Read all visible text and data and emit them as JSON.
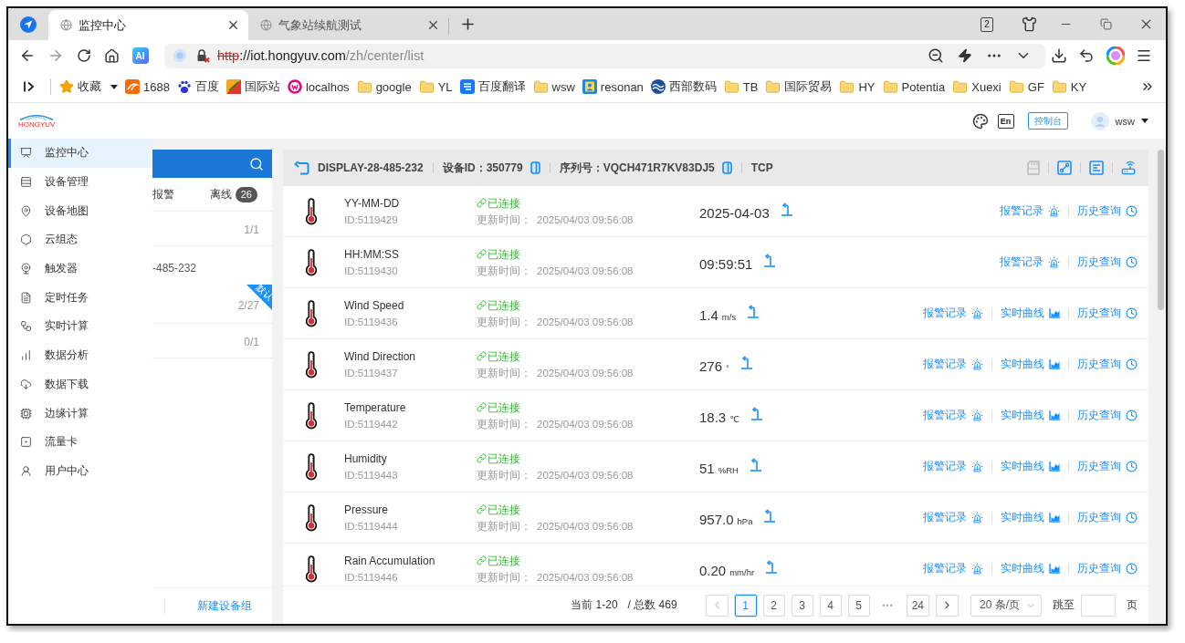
{
  "browser": {
    "tabs": [
      {
        "title": "监控中心",
        "selected": true
      },
      {
        "title": "气象站续航测试",
        "selected": false
      }
    ],
    "window_count": "2",
    "ai_label": "AI",
    "address": {
      "secure": false,
      "scheme": "http",
      "authority": "://iot.hongyuv.com",
      "path": "/zh/center/list"
    },
    "bookmarks": [
      {
        "kind": "favorites",
        "label": "收藏"
      },
      {
        "kind": "site",
        "label": "1688"
      },
      {
        "kind": "site",
        "label": "百度"
      },
      {
        "kind": "site",
        "label": "国际站"
      },
      {
        "kind": "site",
        "label": "localhos"
      },
      {
        "kind": "folder",
        "label": "google"
      },
      {
        "kind": "folder",
        "label": "YL"
      },
      {
        "kind": "site",
        "label": "百度翻译"
      },
      {
        "kind": "folder",
        "label": "wsw"
      },
      {
        "kind": "site",
        "label": "resonan"
      },
      {
        "kind": "site",
        "label": "西部数码"
      },
      {
        "kind": "folder",
        "label": "TB"
      },
      {
        "kind": "folder",
        "label": "国际贸易"
      },
      {
        "kind": "folder",
        "label": "HY"
      },
      {
        "kind": "folder",
        "label": "Potentia"
      },
      {
        "kind": "folder",
        "label": "Xuexi"
      },
      {
        "kind": "folder",
        "label": "GF"
      },
      {
        "kind": "folder",
        "label": "KY"
      }
    ]
  },
  "app": {
    "logo_text": "HONGYUV",
    "lang_label": "En",
    "console_label": "控制台",
    "user": "wsw",
    "nav": [
      {
        "label": "监控中心",
        "selected": true
      },
      {
        "label": "设备管理",
        "selected": false
      },
      {
        "label": "设备地图",
        "selected": false
      },
      {
        "label": "云组态",
        "selected": false
      },
      {
        "label": "触发器",
        "selected": false
      },
      {
        "label": "定时任务",
        "selected": false
      },
      {
        "label": "实时计算",
        "selected": false
      },
      {
        "label": "数据分析",
        "selected": false
      },
      {
        "label": "数据下载",
        "selected": false
      },
      {
        "label": "边缘计算",
        "selected": false
      },
      {
        "label": "流量卡",
        "selected": false
      },
      {
        "label": "用户中心",
        "selected": false
      }
    ],
    "groups": {
      "tabs": [
        {
          "label": "报警"
        },
        {
          "label": "离线",
          "count": "26"
        }
      ],
      "items": [
        {
          "count": "1/1"
        },
        {
          "text": "-485-232",
          "count": "2/27",
          "tag": "默认"
        },
        {
          "count": "0/1"
        }
      ],
      "create_label": "新建设备组"
    },
    "device": {
      "name": "DISPLAY-28-485-232",
      "device_id": "设备ID：350779",
      "serial": "序列号：VQCH471R7KV83DJ5",
      "protocol": "TCP",
      "tools": [
        {
          "disabled": true
        },
        {
          "disabled": false
        },
        {
          "disabled": false
        },
        {
          "disabled": false
        }
      ]
    },
    "sensors": [
      {
        "name": "YY-MM-DD",
        "id": "ID:5119429",
        "status": "已连接",
        "updated_label": "更新时间：",
        "updated": "2025/04/03 09:56:08",
        "value": "2025-04-03",
        "actions": [
          {
            "kind": "alarm",
            "label": "报警记录"
          },
          {
            "kind": "history",
            "label": "历史查询"
          }
        ]
      },
      {
        "name": "HH:MM:SS",
        "id": "ID:5119430",
        "status": "已连接",
        "updated_label": "更新时间：",
        "updated": "2025/04/03 09:56:08",
        "value": "09:59:51",
        "actions": [
          {
            "kind": "alarm",
            "label": "报警记录"
          },
          {
            "kind": "history",
            "label": "历史查询"
          }
        ]
      },
      {
        "name": "Wind Speed",
        "id": "ID:5119436",
        "status": "已连接",
        "updated_label": "更新时间：",
        "updated": "2025/04/03 09:56:08",
        "value": "1.4",
        "unit": "m/s",
        "actions": [
          {
            "kind": "alarm",
            "label": "报警记录"
          },
          {
            "kind": "curve",
            "label": "实时曲线"
          },
          {
            "kind": "history",
            "label": "历史查询"
          }
        ]
      },
      {
        "name": "Wind Direction",
        "id": "ID:5119437",
        "status": "已连接",
        "updated_label": "更新时间：",
        "updated": "2025/04/03 09:56:08",
        "value": "276",
        "unit": "°",
        "actions": [
          {
            "kind": "alarm",
            "label": "报警记录"
          },
          {
            "kind": "curve",
            "label": "实时曲线"
          },
          {
            "kind": "history",
            "label": "历史查询"
          }
        ]
      },
      {
        "name": "Temperature",
        "id": "ID:5119442",
        "status": "已连接",
        "updated_label": "更新时间：",
        "updated": "2025/04/03 09:56:08",
        "value": "18.3",
        "unit": "℃",
        "actions": [
          {
            "kind": "alarm",
            "label": "报警记录"
          },
          {
            "kind": "curve",
            "label": "实时曲线"
          },
          {
            "kind": "history",
            "label": "历史查询"
          }
        ]
      },
      {
        "name": "Humidity",
        "id": "ID:5119443",
        "status": "已连接",
        "updated_label": "更新时间：",
        "updated": "2025/04/03 09:56:08",
        "value": "51",
        "unit": "%RH",
        "actions": [
          {
            "kind": "alarm",
            "label": "报警记录"
          },
          {
            "kind": "curve",
            "label": "实时曲线"
          },
          {
            "kind": "history",
            "label": "历史查询"
          }
        ]
      },
      {
        "name": "Pressure",
        "id": "ID:5119444",
        "status": "已连接",
        "updated_label": "更新时间：",
        "updated": "2025/04/03 09:56:08",
        "value": "957.0",
        "unit": "hPa",
        "actions": [
          {
            "kind": "alarm",
            "label": "报警记录"
          },
          {
            "kind": "curve",
            "label": "实时曲线"
          },
          {
            "kind": "history",
            "label": "历史查询"
          }
        ]
      },
      {
        "name": "Rain Accumulation",
        "id": "ID:5119446",
        "status": "已连接",
        "updated_label": "更新时间：",
        "updated": "2025/04/03 09:56:08",
        "value": "0.20",
        "unit": "mm/hr",
        "actions": [
          {
            "kind": "alarm",
            "label": "报警记录"
          },
          {
            "kind": "curve",
            "label": "实时曲线"
          },
          {
            "kind": "history",
            "label": "历史查询"
          }
        ]
      }
    ],
    "pagination": {
      "range": "当前 1-20",
      "total": "/ 总数 469",
      "prev_disabled": true,
      "next_disabled": false,
      "pages": [
        {
          "kind": "page",
          "label": "1",
          "selected": true
        },
        {
          "kind": "page",
          "label": "2",
          "selected": false
        },
        {
          "kind": "page",
          "label": "3",
          "selected": false
        },
        {
          "kind": "page",
          "label": "4",
          "selected": false
        },
        {
          "kind": "page",
          "label": "5",
          "selected": false
        },
        {
          "kind": "ellipsis",
          "label": "•••"
        },
        {
          "kind": "page",
          "label": "24",
          "selected": false
        }
      ],
      "page_size": "20 条/页",
      "jump_label": "跳至",
      "page_unit": "页"
    }
  }
}
